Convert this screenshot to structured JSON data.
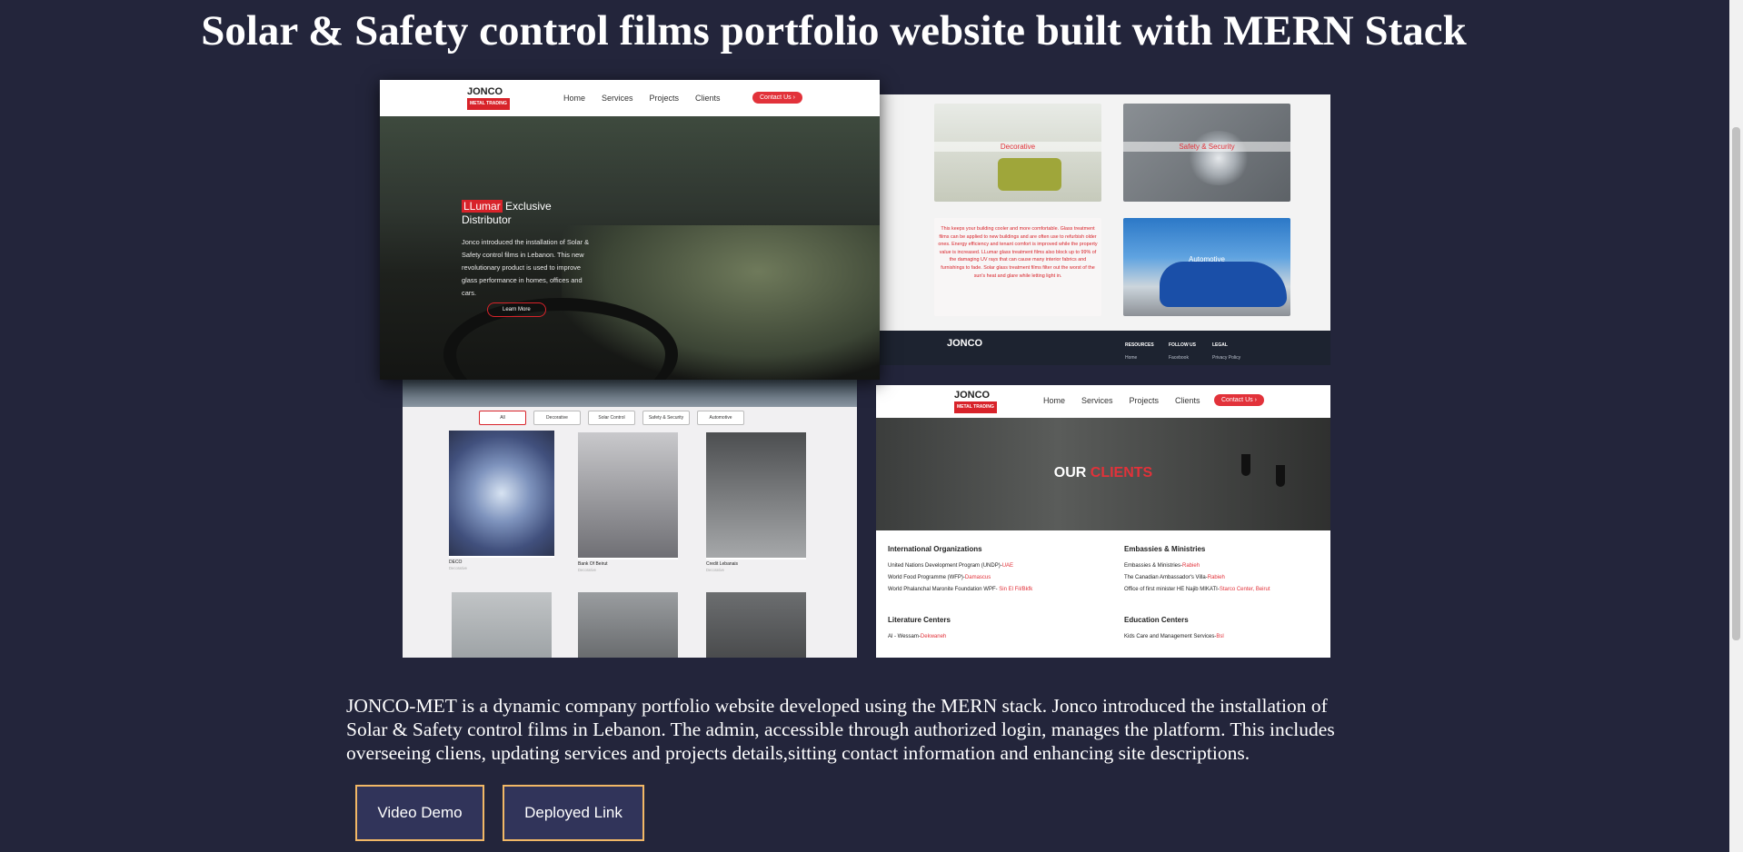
{
  "title": "Solar & Safety control films portfolio website built with MERN Stack",
  "description": "JONCO-MET is a dynamic company portfolio website developed using the MERN stack. Jonco introduced the installation of Solar & Safety control films in Lebanon. The admin, accessible through authorized login, manages the platform. This includes overseeing cliens, updating services and projects details,sitting contact information and enhancing site descriptions.",
  "buttons": {
    "video_demo": "Video Demo",
    "deployed_link": "Deployed Link"
  },
  "shots": {
    "logo": "JONCO",
    "logo_tag": "METAL TRADING",
    "nav": [
      "Home",
      "Services",
      "Projects",
      "Clients"
    ],
    "contact": "Contact Us ›",
    "hero": {
      "brand": "LLumar",
      "heading_rest": " Exclusive Distributor",
      "paragraph": "Jonco introduced the installation of Solar & Safety control films in Lebanon. This new revolutionary product is used to improve glass performance in homes, offices and cars.",
      "learn_more": "Learn More"
    },
    "services": {
      "decorative": "Decorative",
      "safety": "Safety & Security",
      "automotive": "Automotive",
      "paragraph": "This keeps your building cooler and more comfortable. Glass treatment films can be applied to new buildings and are often use to refurbish older ones. Energy efficiency and tenant comfort is improved while the property value is increased. LLumar glass treatment films also block up to 99% of the damaging UV rays that can cause many interior fabrics and furnishings to fade. Solar glass treatment films filter out the worst of the sun's heat and glare while letting light in."
    },
    "footer": {
      "resources": "RESOURCES",
      "resources_link": "Home",
      "follow": "FOLLOW US",
      "follow_link": "Facebook",
      "legal": "LEGAL",
      "legal_link": "Privacy Policy"
    },
    "projects": {
      "filters": [
        "All",
        "Decorative",
        "Solar Control",
        "Safety & Security",
        "Automotive"
      ],
      "items": [
        {
          "name": "DECO",
          "category": "Decorative"
        },
        {
          "name": "Bank Of Beirut",
          "category": "Decorative"
        },
        {
          "name": "Credit Lebanais",
          "category": "Decorative"
        }
      ]
    },
    "clients": {
      "title_white": "OUR ",
      "title_red": "CLIENTS",
      "international_title": "International Organizations",
      "international": [
        {
          "name": "United Nations Development Program (UNDP)-",
          "loc": "UAE"
        },
        {
          "name": "World Food Programme (WFP)-",
          "loc": "Damascus"
        },
        {
          "name": "World Phalanchal Maronite Foundation WPF- ",
          "loc": "Sin El Fil/Bkfk"
        }
      ],
      "embassies_title": "Embassies & Ministries",
      "embassies": [
        {
          "name": "Embassies & Ministries-",
          "loc": "Rabieh"
        },
        {
          "name": "The Canadian Ambassador's Villa-",
          "loc": "Rabieh"
        },
        {
          "name": "Office of first minister HE Najib MIKATI-",
          "loc": "Starco Center, Beirut"
        }
      ],
      "literature_title": "Literature Centers",
      "literature": [
        {
          "name": "Al - Wessam-",
          "loc": "Dekwaneh"
        }
      ],
      "education_title": "Education Centers",
      "education": [
        {
          "name": "Kids Care and Management Services-",
          "loc": "Bsl"
        }
      ]
    }
  }
}
